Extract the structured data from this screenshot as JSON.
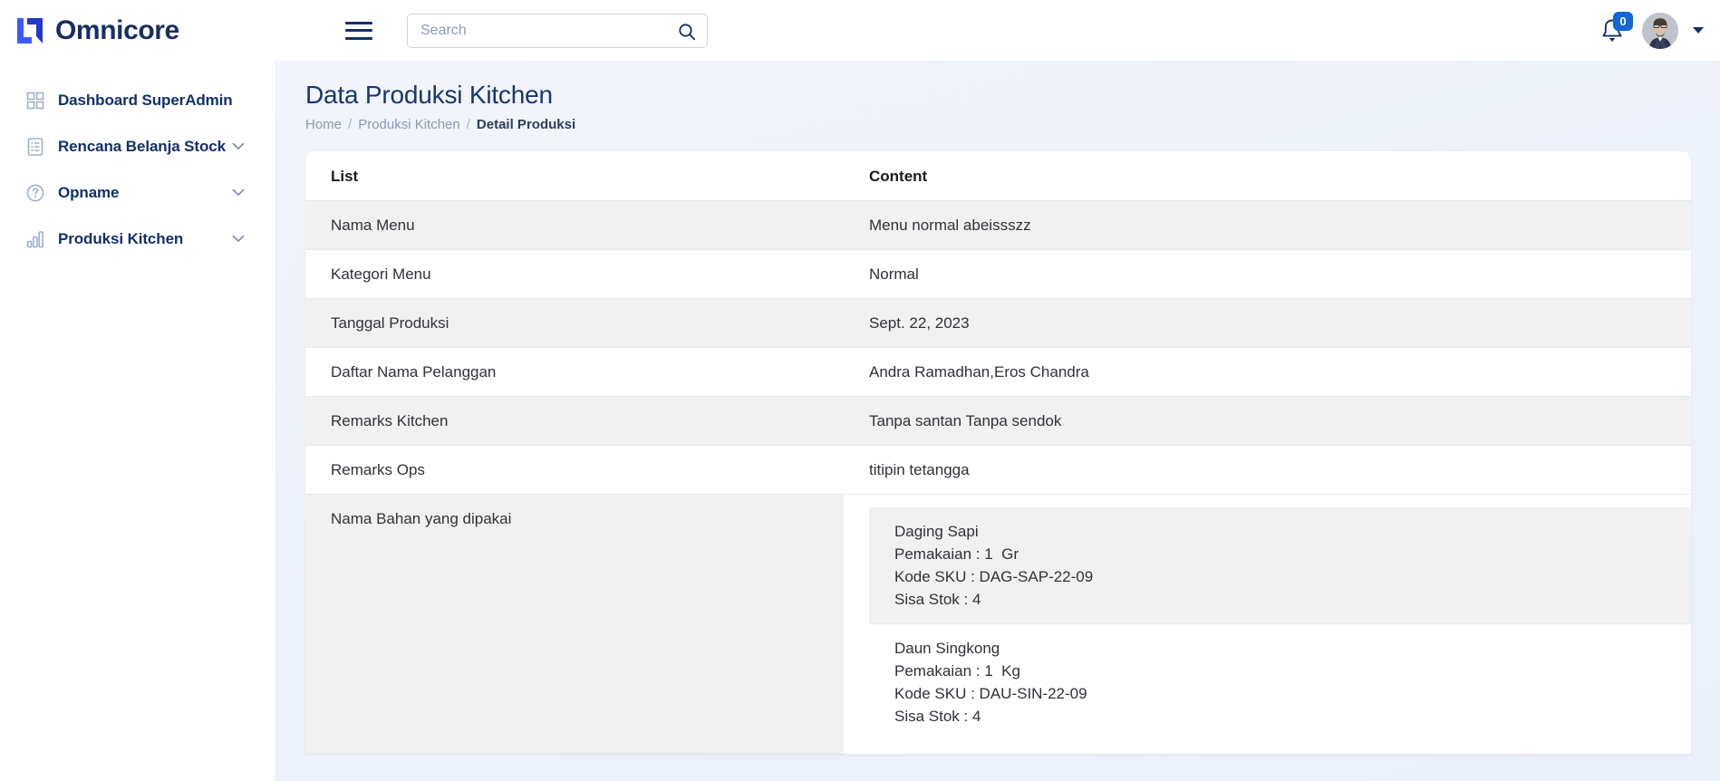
{
  "brand": {
    "name": "Omnicore",
    "logo_icon": "omnicore-logo-icon",
    "accent": "#3d5afe",
    "dark": "#172f63"
  },
  "topbar": {
    "menu_toggle_icon": "hamburger-icon",
    "search": {
      "placeholder": "Search",
      "value": "",
      "icon": "search-icon"
    },
    "notifications": {
      "icon": "bell-icon",
      "count": "0",
      "badge_color": "#1266d6"
    },
    "avatar": {
      "icon": "user-avatar",
      "alt": "User profile photo"
    },
    "profile_caret_icon": "chevron-down-icon"
  },
  "sidebar": {
    "items": [
      {
        "label": "Dashboard SuperAdmin",
        "icon": "grid-icon",
        "has_chevron": false
      },
      {
        "label": "Rencana Belanja Stock",
        "icon": "document-list-icon",
        "has_chevron": true
      },
      {
        "label": "Opname",
        "icon": "question-circle-icon",
        "has_chevron": true
      },
      {
        "label": "Produksi Kitchen",
        "icon": "bar-chart-icon",
        "has_chevron": true
      }
    ],
    "chevron_icon": "chevron-down-icon"
  },
  "page": {
    "title": "Data Produksi Kitchen",
    "breadcrumb": [
      {
        "label": "Home",
        "current": false
      },
      {
        "label": "Produksi Kitchen",
        "current": false
      },
      {
        "label": "Detail Produksi",
        "current": true
      }
    ],
    "breadcrumb_separator": "/"
  },
  "table": {
    "headers": {
      "list": "List",
      "content": "Content"
    },
    "rows": [
      {
        "list": "Nama Menu",
        "content": "Menu normal abeissszz"
      },
      {
        "list": "Kategori Menu",
        "content": "Normal"
      },
      {
        "list": "Tanggal Produksi",
        "content": "Sept. 22, 2023"
      },
      {
        "list": "Daftar Nama Pelanggan",
        "content": "Andra Ramadhan,Eros Chandra"
      },
      {
        "list": "Remarks Kitchen",
        "content": "Tanpa santan Tanpa sendok"
      },
      {
        "list": "Remarks Ops",
        "content": "titipin tetangga"
      }
    ],
    "ingredients_label": "Nama Bahan yang dipakai",
    "ingredients": [
      {
        "name": "Daging Sapi",
        "pemakaian": "Pemakaian : 1  Gr",
        "kode_sku": "Kode SKU : DAG-SAP-22-09",
        "sisa_stok": "Sisa Stok : 4"
      },
      {
        "name": "Daun Singkong",
        "pemakaian": "Pemakaian : 1  Kg",
        "kode_sku": "Kode SKU : DAU-SIN-22-09",
        "sisa_stok": "Sisa Stok : 4"
      }
    ]
  }
}
